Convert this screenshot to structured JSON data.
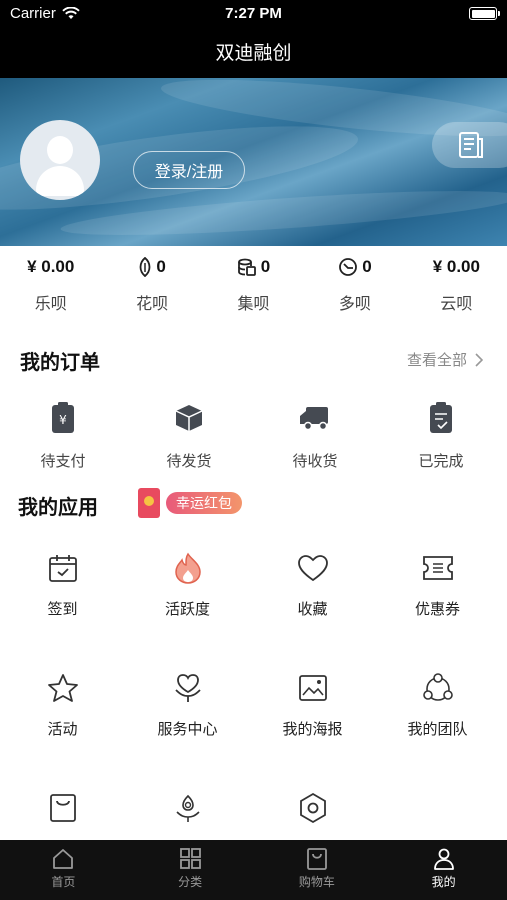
{
  "status_bar": {
    "carrier": "Carrier",
    "time": "7:27 PM"
  },
  "nav": {
    "title": "双迪融创"
  },
  "header": {
    "login_label": "登录/注册"
  },
  "stats": [
    {
      "value": "¥ 0.00",
      "label": "乐呗",
      "icon": ""
    },
    {
      "value": "0",
      "label": "花呗",
      "icon": "seed-icon"
    },
    {
      "value": "0",
      "label": "集呗",
      "icon": "coins-icon"
    },
    {
      "value": "0",
      "label": "多呗",
      "icon": "clock-icon"
    },
    {
      "value": "¥ 0.00",
      "label": "云呗",
      "icon": ""
    }
  ],
  "orders": {
    "title": "我的订单",
    "view_all": "查看全部",
    "items": [
      {
        "label": "待支付",
        "icon": "wallet-icon"
      },
      {
        "label": "待发货",
        "icon": "box-icon"
      },
      {
        "label": "待收货",
        "icon": "truck-icon"
      },
      {
        "label": "已完成",
        "icon": "clipboard-check-icon"
      }
    ]
  },
  "apps": {
    "title": "我的应用",
    "badge": "幸运红包",
    "items": [
      {
        "label": "签到",
        "icon": "calendar-icon"
      },
      {
        "label": "活跃度",
        "icon": "flame-icon"
      },
      {
        "label": "收藏",
        "icon": "heart-icon"
      },
      {
        "label": "优惠券",
        "icon": "ticket-icon"
      },
      {
        "label": "活动",
        "icon": "star-icon"
      },
      {
        "label": "服务中心",
        "icon": "service-icon"
      },
      {
        "label": "我的海报",
        "icon": "image-icon"
      },
      {
        "label": "我的团队",
        "icon": "team-icon"
      },
      {
        "label": "",
        "icon": "bag-icon"
      },
      {
        "label": "",
        "icon": "flower-icon"
      },
      {
        "label": "",
        "icon": "hexagon-icon"
      }
    ]
  },
  "tabbar": {
    "tabs": [
      {
        "label": "首页",
        "icon": "home-icon"
      },
      {
        "label": "分类",
        "icon": "grid-icon"
      },
      {
        "label": "购物车",
        "icon": "cart-icon"
      },
      {
        "label": "我的",
        "icon": "person-icon",
        "active": true
      }
    ]
  }
}
